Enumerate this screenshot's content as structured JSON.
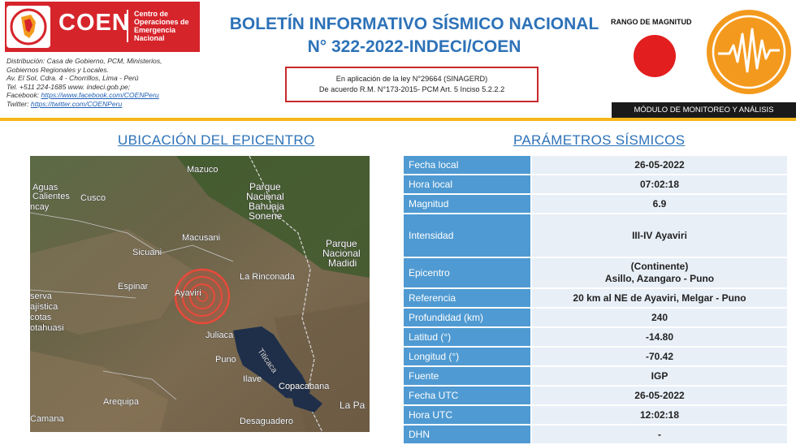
{
  "header": {
    "logo_text": "COEN",
    "logo_subtitle": [
      "Centro de",
      "Operaciones de",
      "Emergencia",
      "Nacional"
    ],
    "contact_lines": [
      "Distribución: Casa de Gobierno, PCM, Ministerios,",
      "Gobiernos Regionales y Locales.",
      "Av. El Sol, Cdra. 4 - Chorrillos, Lima - Perú",
      "Tel. +511 224-1685 www. indeci.gob.pe;"
    ],
    "facebook_prefix": "Facebook: ",
    "facebook_link": "https://www.facebook.com/COENPeru",
    "twitter_prefix": "Twitter: ",
    "twitter_link": "https://twitter.com/COENPeru",
    "title_line1": "BOLETÍN INFORMATIVO SÍSMICO NACIONAL",
    "title_line2": "N° 322-2022-INDECI/COEN",
    "law_line1": "En aplicación de la ley N°29664 (SINAGERD)",
    "law_line2": "De acuerdo R.M. N°173-2015- PCM Art. 5 Inciso 5.2.2.2",
    "rango_label": "RANGO DE MAGNITUD",
    "modulo_label": "MÓDULO DE MONITOREO Y ANÁLISIS"
  },
  "colors": {
    "brand_red": "#d6242b",
    "title_blue": "#2d72b8",
    "label_blue": "#4f9ad2",
    "magnitude_red": "#e31e1e",
    "orange": "#f39a1e",
    "yellow": "#f6b71d"
  },
  "sections": {
    "epicenter_title": "UBICACIÓN DEL EPICENTRO",
    "params_title": "PARÁMETROS SÍSMICOS"
  },
  "map": {
    "labels": {
      "mazuco": "Mazuco",
      "aguas1": "Aguas",
      "aguas2": "Calientes",
      "cusco": "Cusco",
      "ncay": "ncay",
      "parque_bahuaja1": "Parque",
      "parque_bahuaja2": "Nacional",
      "parque_bahuaja3": "Bahuaja",
      "parque_bahuaja4": "Sonene",
      "macusani": "Macusani",
      "sicuani": "Sicuani",
      "parque_madidi1": "Parque",
      "parque_madidi2": "Nacional",
      "parque_madidi3": "Madidi",
      "la_rinconada": "La Rinconada",
      "espinar": "Espinar",
      "ayaviri": "Ayaviri",
      "reserva1": "serva",
      "reserva2": "ajística",
      "reserva3": "cotas",
      "reserva4": "otahuasi",
      "juliaca": "Juliaca",
      "puno": "Puno",
      "titicaca": "Titicaca",
      "ilave": "Ilave",
      "copacabana": "Copacabana",
      "arequipa": "Arequipa",
      "la_paz": "La Pa",
      "camana": "Camana",
      "desaguadero": "Desaguadero"
    }
  },
  "params": [
    {
      "label": "Fecha local",
      "value": [
        "26-05-2022"
      ]
    },
    {
      "label": "Hora local",
      "value": [
        "07:02:18"
      ]
    },
    {
      "label": "Magnitud",
      "value": [
        "6.9"
      ]
    },
    {
      "label": "Intensidad",
      "value": [
        "III-IV Ayaviri"
      ]
    },
    {
      "label": "Epicentro",
      "value": [
        "(Continente)",
        "Asillo, Azangaro - Puno"
      ]
    },
    {
      "label": "Referencia",
      "value": [
        "20 km al NE de Ayaviri, Melgar - Puno"
      ]
    },
    {
      "label": "Profundidad (km)",
      "value": [
        "240"
      ]
    },
    {
      "label": "Latitud (°)",
      "value": [
        "-14.80"
      ]
    },
    {
      "label": "Longitud (°)",
      "value": [
        "-70.42"
      ]
    },
    {
      "label": "Fuente",
      "value": [
        "IGP"
      ]
    },
    {
      "label": "Fecha UTC",
      "value": [
        "26-05-2022"
      ]
    },
    {
      "label": "Hora UTC",
      "value": [
        "12:02:18"
      ]
    },
    {
      "label": "DHN",
      "value": [
        "-"
      ]
    }
  ]
}
